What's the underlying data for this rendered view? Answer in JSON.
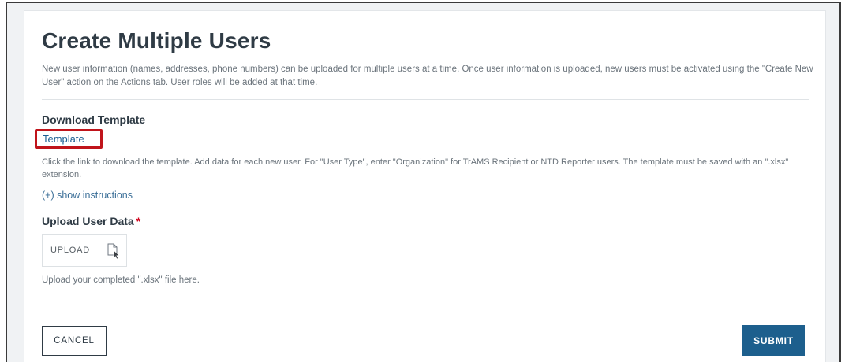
{
  "page": {
    "title": "Create Multiple Users",
    "intro": "New user information (names, addresses, phone numbers) can be uploaded for multiple users at a time. Once user information is uploaded, new users must be activated using the \"Create New User\" action on the Actions tab. User roles will be added at that time."
  },
  "download": {
    "heading": "Download Template",
    "link_label": "Template",
    "help": "Click the link to download the template. Add data for each new user. For \"User Type\", enter \"Organization\" for TrAMS Recipient or NTD Reporter users. The template must be saved with an \".xlsx\" extension.",
    "instructions_toggle": "(+) show instructions"
  },
  "upload": {
    "heading": "Upload User Data",
    "required_marker": "*",
    "button_label": "UPLOAD",
    "icon": "file-cursor-icon",
    "help": "Upload your completed \".xlsx\" file here."
  },
  "actions": {
    "cancel_label": "CANCEL",
    "submit_label": "SUBMIT"
  },
  "colors": {
    "highlight": "#c0141b",
    "primary": "#1d5f8d",
    "required": "#d0021b"
  }
}
